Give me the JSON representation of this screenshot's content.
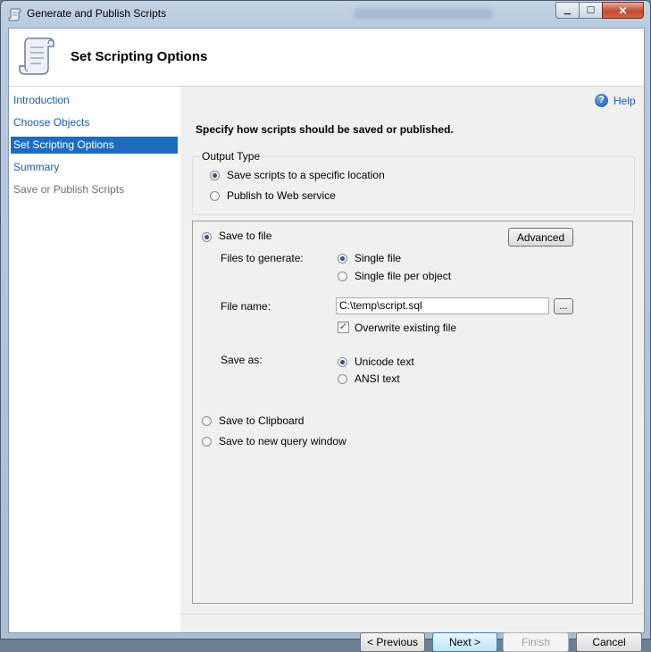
{
  "window": {
    "title": "Generate and Publish Scripts",
    "min_glyph": "▁",
    "max_glyph": "☐",
    "close_glyph": "✕"
  },
  "header": {
    "title": "Set Scripting Options"
  },
  "nav": {
    "items": [
      {
        "label": "Introduction"
      },
      {
        "label": "Choose Objects"
      },
      {
        "label": "Set Scripting Options"
      },
      {
        "label": "Summary"
      },
      {
        "label": "Save or Publish Scripts"
      }
    ]
  },
  "help": {
    "icon_glyph": "?",
    "label": "Help"
  },
  "main": {
    "instruction": "Specify how scripts should be saved or published.",
    "output_type": {
      "legend": "Output Type",
      "options": [
        "Save scripts to a specific location",
        "Publish to Web service"
      ]
    },
    "save_to_file": {
      "label": "Save to file",
      "advanced_label": "Advanced",
      "files_to_generate_label": "Files to generate:",
      "files_options": [
        "Single file",
        "Single file per object"
      ],
      "file_name_label": "File name:",
      "file_name_value": "C:\\temp\\script.sql",
      "browse_label": "...",
      "overwrite_label": "Overwrite existing file",
      "overwrite_checked": true,
      "check_glyph": "✓",
      "save_as_label": "Save as:",
      "save_as_options": [
        "Unicode text",
        "ANSI text"
      ]
    },
    "clipboard_label": "Save to Clipboard",
    "query_window_label": "Save to new query window"
  },
  "footer": {
    "previous": "< Previous",
    "next": "Next >",
    "finish": "Finish",
    "cancel": "Cancel"
  }
}
